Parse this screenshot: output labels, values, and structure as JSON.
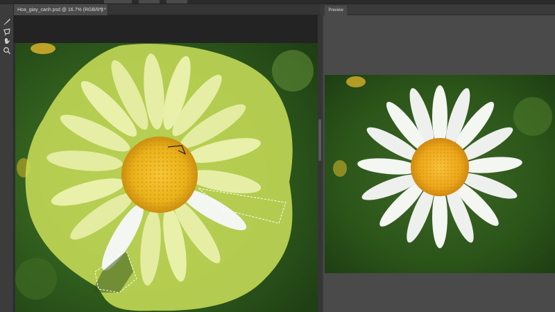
{
  "document": {
    "tab_title": "Hoa_giay_canh.psd @ 16.7% (RGB/8*) *",
    "close_glyph": "×"
  },
  "tools": [
    {
      "icon": "brush-icon"
    },
    {
      "icon": "lasso-icon"
    },
    {
      "icon": "hand-icon"
    },
    {
      "icon": "zoom-icon"
    }
  ],
  "preview": {
    "tab_label": "Preview"
  },
  "colors": {
    "overlay": "#c8de5a",
    "background_green": "#2f5a1f",
    "petal_white": "#f4f6f2",
    "petal_tint": "#e6eea6",
    "center_yellow": "#f0b21a"
  }
}
